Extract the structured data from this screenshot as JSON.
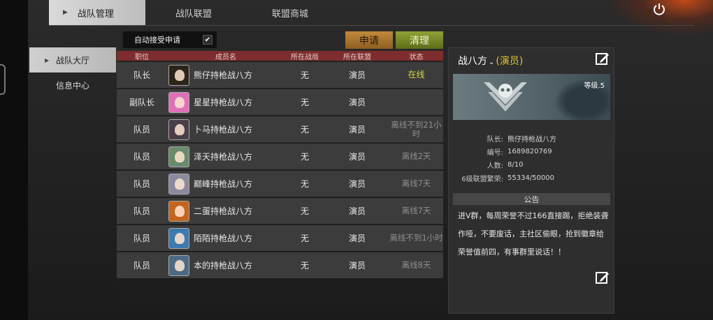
{
  "tabs": [
    {
      "label": "战队管理",
      "active": true
    },
    {
      "label": "战队联盟",
      "active": false
    },
    {
      "label": "联盟商城",
      "active": false
    }
  ],
  "left_nav": [
    {
      "label": "战队大厅",
      "active": true
    },
    {
      "label": "信息中心",
      "active": false
    }
  ],
  "toolbar": {
    "auto_accept_label": "自动接受申请",
    "auto_accept_checked": true,
    "apply_label": "申请",
    "clear_label": "清理"
  },
  "table": {
    "headers": [
      "职位",
      "成员名",
      "所在战局",
      "所在联盟",
      "状态"
    ],
    "rows": [
      {
        "position": "队长",
        "name": "熊仔持枪战八方",
        "battle": "无",
        "alliance": "演员",
        "status": "在线",
        "online": true,
        "avatar_color": "#2b2418"
      },
      {
        "position": "副队长",
        "name": "星星持枪战八方",
        "battle": "无",
        "alliance": "演员",
        "status": "",
        "online": false,
        "avatar_color": "#e070b8"
      },
      {
        "position": "队员",
        "name": "卜马持枪战八方",
        "battle": "无",
        "alliance": "演员",
        "status": "离线不到21小时",
        "online": false,
        "avatar_color": "#4a3e48"
      },
      {
        "position": "队员",
        "name": "泽天持枪战八方",
        "battle": "无",
        "alliance": "演员",
        "status": "离线2天",
        "online": false,
        "avatar_color": "#6a8a6c"
      },
      {
        "position": "队员",
        "name": "巅峰持枪战八方",
        "battle": "无",
        "alliance": "演员",
        "status": "离线7天",
        "online": false,
        "avatar_color": "#8c8a9e"
      },
      {
        "position": "队员",
        "name": "二蛋持枪战八方",
        "battle": "无",
        "alliance": "演员",
        "status": "离线7天",
        "online": false,
        "avatar_color": "#c4641e"
      },
      {
        "position": "队员",
        "name": "陌陌持枪战八方",
        "battle": "无",
        "alliance": "演员",
        "status": "离线不到1小时",
        "online": false,
        "avatar_color": "#3c7ab0"
      },
      {
        "position": "队员",
        "name": "本的持枪战八方",
        "battle": "无",
        "alliance": "演员",
        "status": "离线8天",
        "online": false,
        "avatar_color": "#4c6a86"
      }
    ]
  },
  "panel": {
    "team_name": "战八方",
    "alliance_role": "(演员)",
    "level": "等级.5",
    "info": [
      {
        "key": "队长:",
        "value": "熊仔持枪战八方"
      },
      {
        "key": "编号:",
        "value": "1689820769"
      },
      {
        "key": "人数:",
        "value": "8/10"
      },
      {
        "key": "6级联盟繁荣:",
        "value": "55334/50000"
      }
    ],
    "notice_title": "公告",
    "notice_text": "进V群，每周荣誉不过166直接踢，拒绝装聋作哑，不要废话，主社区偷眼，抢到徽章给荣誉值前四，有事群里说话！！"
  },
  "colors": {
    "header_red": "#7d2d2d",
    "online_yellow": "#d8d83a",
    "apply_orange": "#c08a3c",
    "clear_green": "#8fa235",
    "role_yellow": "#e0c534"
  },
  "icons": [
    "power-icon",
    "edit-icon",
    "checkbox-icon",
    "chevron-down-icon",
    "skull-emblem-icon"
  ]
}
